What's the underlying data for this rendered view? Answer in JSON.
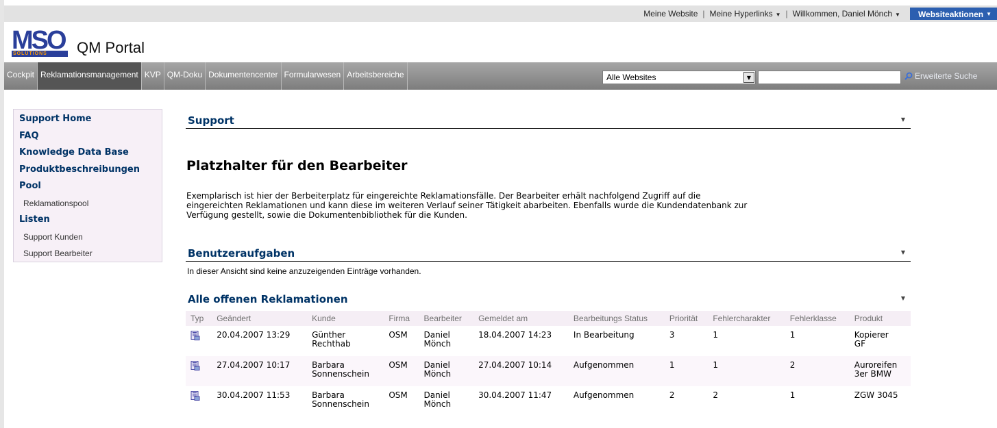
{
  "topbar": {
    "my_site": "Meine Website",
    "my_links": "Meine Hyperlinks",
    "welcome": "Willkommen, Daniel Mönch",
    "site_actions": "Websiteaktionen"
  },
  "brand": {
    "logo_text": "MSO SOLUTIONS",
    "title": "QM Portal"
  },
  "nav": {
    "tabs": [
      "Cockpit",
      "Reklamationsmanagement",
      "KVP",
      "QM-Doku",
      "Dokumentencenter",
      "Formularwesen",
      "Arbeitsbereiche"
    ],
    "active_tab": "Reklamationsmanagement",
    "scope_value": "Alle Websites",
    "search_value": "",
    "search_label": "Erweiterte Suche"
  },
  "sidebar": {
    "items": [
      {
        "label": "Support Home",
        "type": "heading"
      },
      {
        "label": "FAQ",
        "type": "heading"
      },
      {
        "label": "Knowledge Data Base",
        "type": "heading"
      },
      {
        "label": "Produktbeschreibungen",
        "type": "heading"
      },
      {
        "label": "Pool",
        "type": "heading"
      },
      {
        "label": "Reklamationspool",
        "type": "sub"
      },
      {
        "label": "Listen",
        "type": "heading"
      },
      {
        "label": "Support Kunden",
        "type": "sub"
      },
      {
        "label": "Support Bearbeiter",
        "type": "sub"
      }
    ]
  },
  "main": {
    "support_header": "Support",
    "page_heading": "Platzhalter für den Bearbeiter",
    "description_lines": [
      "Exemplarisch ist hier der Berbeiterplatz für eingereichte Reklamationsfälle. Der Bearbeiter erhält nachfolgend Zugriff auf die",
      "eingereichten Reklamationen und kann diese im weiteren Verlauf seiner Tätigkeit abarbeiten. Ebenfalls wurde die Kundendatenbank zur",
      "Verfügung gestellt, sowie die Dokumentenbibliothek für die Kunden."
    ],
    "tasks_header": "Benutzeraufgaben",
    "tasks_empty": "In dieser Ansicht sind keine anzuzeigenden Einträge vorhanden.",
    "complaints_header": "Alle offenen Reklamationen",
    "columns": [
      "Typ",
      "Geändert",
      "Kunde",
      "Firma",
      "Bearbeiter",
      "Gemeldet am",
      "Bearbeitungs Status",
      "Priorität",
      "Fehlercharakter",
      "Fehlerklasse",
      "Produkt"
    ],
    "rows": [
      {
        "typ_icon": "document-icon",
        "geaendert": "20.04.2007 13:29",
        "kunde": [
          "Günther",
          "Rechthab"
        ],
        "firma": "OSM",
        "bearbeiter": [
          "Daniel",
          "Mönch"
        ],
        "gemeldet": "18.04.2007 14:23",
        "status": "In Bearbeitung",
        "prioritaet": "3",
        "fehlercharakter": "1",
        "fehlerklasse": "1",
        "produkt": [
          "Kopierer",
          "GF"
        ]
      },
      {
        "typ_icon": "document-icon",
        "geaendert": "27.04.2007 10:17",
        "kunde": [
          "Barbara",
          "Sonnenschein"
        ],
        "firma": "OSM",
        "bearbeiter": [
          "Daniel",
          "Mönch"
        ],
        "gemeldet": "27.04.2007 10:14",
        "status": "Aufgenommen",
        "prioritaet": "1",
        "fehlercharakter": "1",
        "fehlerklasse": "2",
        "produkt": [
          "Auroreifen",
          "3er BMW"
        ]
      },
      {
        "typ_icon": "document-icon",
        "geaendert": "30.04.2007 11:53",
        "kunde": [
          "Barbara",
          "Sonnenschein"
        ],
        "firma": "OSM",
        "bearbeiter": [
          "Daniel",
          "Mönch"
        ],
        "gemeldet": "30.04.2007 11:47",
        "status": "Aufgenommen",
        "prioritaet": "2",
        "fehlercharakter": "2",
        "fehlerklasse": "1",
        "produkt": [
          "ZGW 3045"
        ]
      }
    ]
  }
}
